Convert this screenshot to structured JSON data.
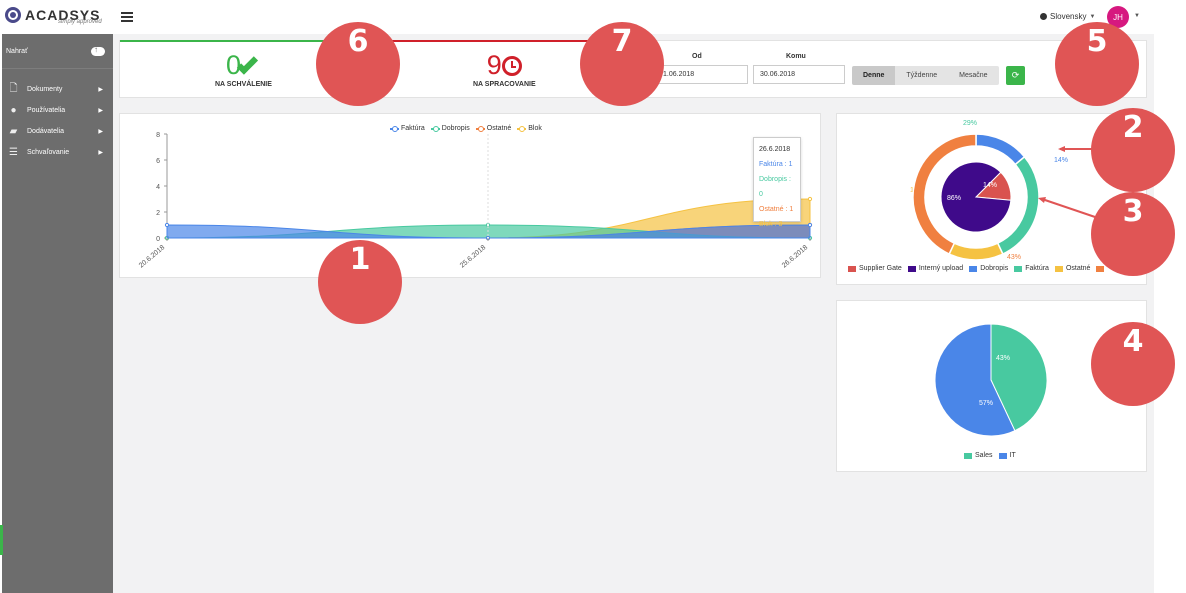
{
  "app": {
    "logo_text": "ACADSYS",
    "logo_tagline": "simply approved"
  },
  "topbar": {
    "language": "Slovensky",
    "user_initials": "JH"
  },
  "sidebar": {
    "upload_label": "Nahrať",
    "items": [
      {
        "label": "Dokumenty",
        "icon": "document-icon"
      },
      {
        "label": "Používatelia",
        "icon": "users-icon"
      },
      {
        "label": "Dodávatelia",
        "icon": "truck-icon"
      },
      {
        "label": "Schvaľovanie",
        "icon": "list-icon"
      }
    ]
  },
  "status": {
    "approval": {
      "count": "0",
      "label": "NA SCHVÁLENIE",
      "color": "#3bb54a"
    },
    "processing": {
      "count": "9",
      "label": "NA SPRACOVANIE",
      "color": "#d0202a"
    }
  },
  "filter": {
    "from_label": "Od",
    "from_value": "1.06.2018",
    "to_label": "Komu",
    "to_value": "30.06.2018",
    "periods": [
      "Denne",
      "Týždenne",
      "Mesačne"
    ],
    "active_period": "Denne"
  },
  "tooltip": {
    "date": "26.6.2018",
    "rows": [
      "Faktúra : 1",
      "Dobropis : 0",
      "Ostatné : 1",
      "Blok : 3"
    ]
  },
  "badges": [
    "1",
    "2",
    "3",
    "4",
    "5",
    "6",
    "7"
  ],
  "chart_data": [
    {
      "type": "area",
      "x": [
        "20.6.2018",
        "25.6.2018",
        "26.6.2018"
      ],
      "x_tick_labels": [
        "20.6.2018",
        "25.6.2018",
        "26.6.2018"
      ],
      "ylim": [
        0,
        8
      ],
      "y_ticks": [
        0,
        2,
        4,
        6,
        8
      ],
      "legend_position": "top-center",
      "series": [
        {
          "name": "Faktúra",
          "color": "#4a86e8",
          "values": [
            1,
            0,
            1
          ]
        },
        {
          "name": "Dobropis",
          "color": "#48c9a0",
          "values": [
            0,
            1,
            0
          ]
        },
        {
          "name": "Ostatné",
          "color": "#f08040",
          "values": [
            0,
            0,
            1
          ]
        },
        {
          "name": "Blok",
          "color": "#f5c242",
          "values": [
            0,
            0,
            3
          ]
        }
      ]
    },
    {
      "type": "pie",
      "variant": "nested-donut",
      "legend_position": "bottom",
      "inner": [
        {
          "name": "Supplier Gate",
          "value": 14,
          "label": "14%",
          "color": "#d9534f"
        },
        {
          "name": "Interný upload",
          "value": 86,
          "label": "86%",
          "color": "#3f0a8a"
        }
      ],
      "outer": [
        {
          "name": "Dobropis",
          "value": 14,
          "label": "14%",
          "color": "#4a86e8"
        },
        {
          "name": "Faktúra",
          "value": 29,
          "label": "29%",
          "color": "#48c9a0"
        },
        {
          "name": "Ostatné",
          "value": 14,
          "label": "14%",
          "color": "#f5c242"
        },
        {
          "name": "",
          "value": 43,
          "label": "43%",
          "color": "#f08040"
        }
      ],
      "legend": [
        {
          "name": "Supplier Gate",
          "color": "#d9534f"
        },
        {
          "name": "Interný upload",
          "color": "#3f0a8a"
        },
        {
          "name": "Dobropis",
          "color": "#4a86e8"
        },
        {
          "name": "Faktúra",
          "color": "#48c9a0"
        },
        {
          "name": "Ostatné",
          "color": "#f5c242"
        },
        {
          "name": "",
          "color": "#f08040"
        }
      ]
    },
    {
      "type": "pie",
      "legend_position": "bottom",
      "slices": [
        {
          "name": "Sales",
          "value": 43,
          "label": "43%",
          "color": "#48c9a0"
        },
        {
          "name": "IT",
          "value": 57,
          "label": "57%",
          "color": "#4a86e8"
        }
      ]
    }
  ]
}
